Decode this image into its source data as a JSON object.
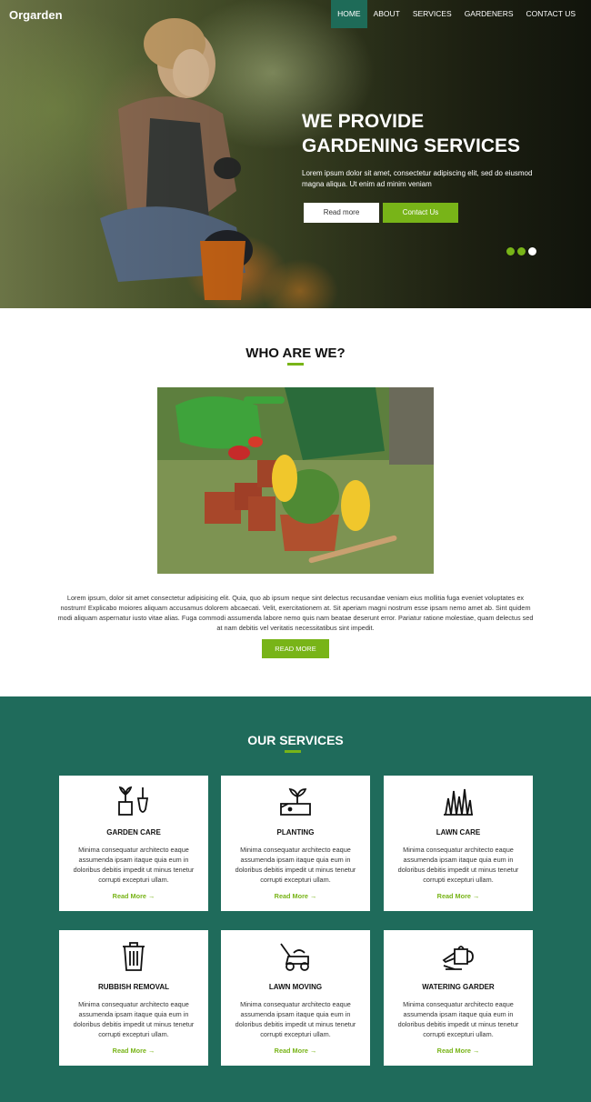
{
  "brand": "Orgarden",
  "nav": [
    "HOME",
    "ABOUT",
    "SERVICES",
    "GARDENERS",
    "CONTACT US"
  ],
  "hero": {
    "title_line1": "WE PROVIDE",
    "title_line2": "GARDENING SERVICES",
    "text": "Lorem ipsum dolor sit amet, consectetur adipiscing elit, sed do eiusmod magna aliqua. Ut enim ad minim veniam",
    "read_more": "Read more",
    "contact": "Contact Us"
  },
  "who": {
    "title": "WHO ARE WE?",
    "text": "Lorem ipsum, dolor sit amet consectetur adipisicing elit. Quia, quo ab ipsum neque sint delectus recusandae veniam eius mollitia fuga eveniet voluptates ex nostrum! Explicabo moiores aliquam accusamus dolorem abcaecati. Velit, exercitationem at. Sit aperiam magni nostrum esse ipsam nemo amet ab. Sint quidem modi aliquam aspernatur iusto vitae alias. Fuga commodi assumenda labore nemo quis nam beatae deserunt error. Pariatur ratione molestiae, quam delectus sed at nam debitis vel veritatis necessitatibus sint impedit.",
    "button": "READ MORE"
  },
  "services": {
    "title": "OUR SERVICES",
    "items": [
      {
        "name": "GARDEN CARE",
        "icon": "garden-care-icon",
        "desc": "Minima consequatur architecto eaque assumenda ipsam itaque quia eum in doloribus debitis impedit ut minus tenetur corrupti excepturi ullam.",
        "link": "Read More →"
      },
      {
        "name": "PLANTING",
        "icon": "planting-icon",
        "desc": "Minima consequatur architecto eaque assumenda ipsam itaque quia eum in doloribus debitis impedit ut minus tenetur corrupti excepturi ullam.",
        "link": "Read More →"
      },
      {
        "name": "LAWN CARE",
        "icon": "lawn-care-icon",
        "desc": "Minima consequatur architecto eaque assumenda ipsam itaque quia eum in doloribus debitis impedit ut minus tenetur corrupti excepturi ullam.",
        "link": "Read More →"
      },
      {
        "name": "RUBBISH REMOVAL",
        "icon": "rubbish-bin-icon",
        "desc": "Minima consequatur architecto eaque assumenda ipsam itaque quia eum in doloribus debitis impedit ut minus tenetur corrupti excepturi ullam.",
        "link": "Read More →"
      },
      {
        "name": "LAWN MOVING",
        "icon": "lawn-mower-icon",
        "desc": "Minima consequatur architecto eaque assumenda ipsam itaque quia eum in doloribus debitis impedit ut minus tenetur corrupti excepturi ullam.",
        "link": "Read More →"
      },
      {
        "name": "WATERING GARDER",
        "icon": "watering-can-icon",
        "desc": "Minima consequatur architecto eaque assumenda ipsam itaque quia eum in doloribus debitis impedit ut minus tenetur corrupti excepturi ullam.",
        "link": "Read More →"
      }
    ]
  },
  "colors": {
    "accent": "#78b418",
    "primary": "#1f6b5b",
    "nav_active": "#1e6b58"
  }
}
